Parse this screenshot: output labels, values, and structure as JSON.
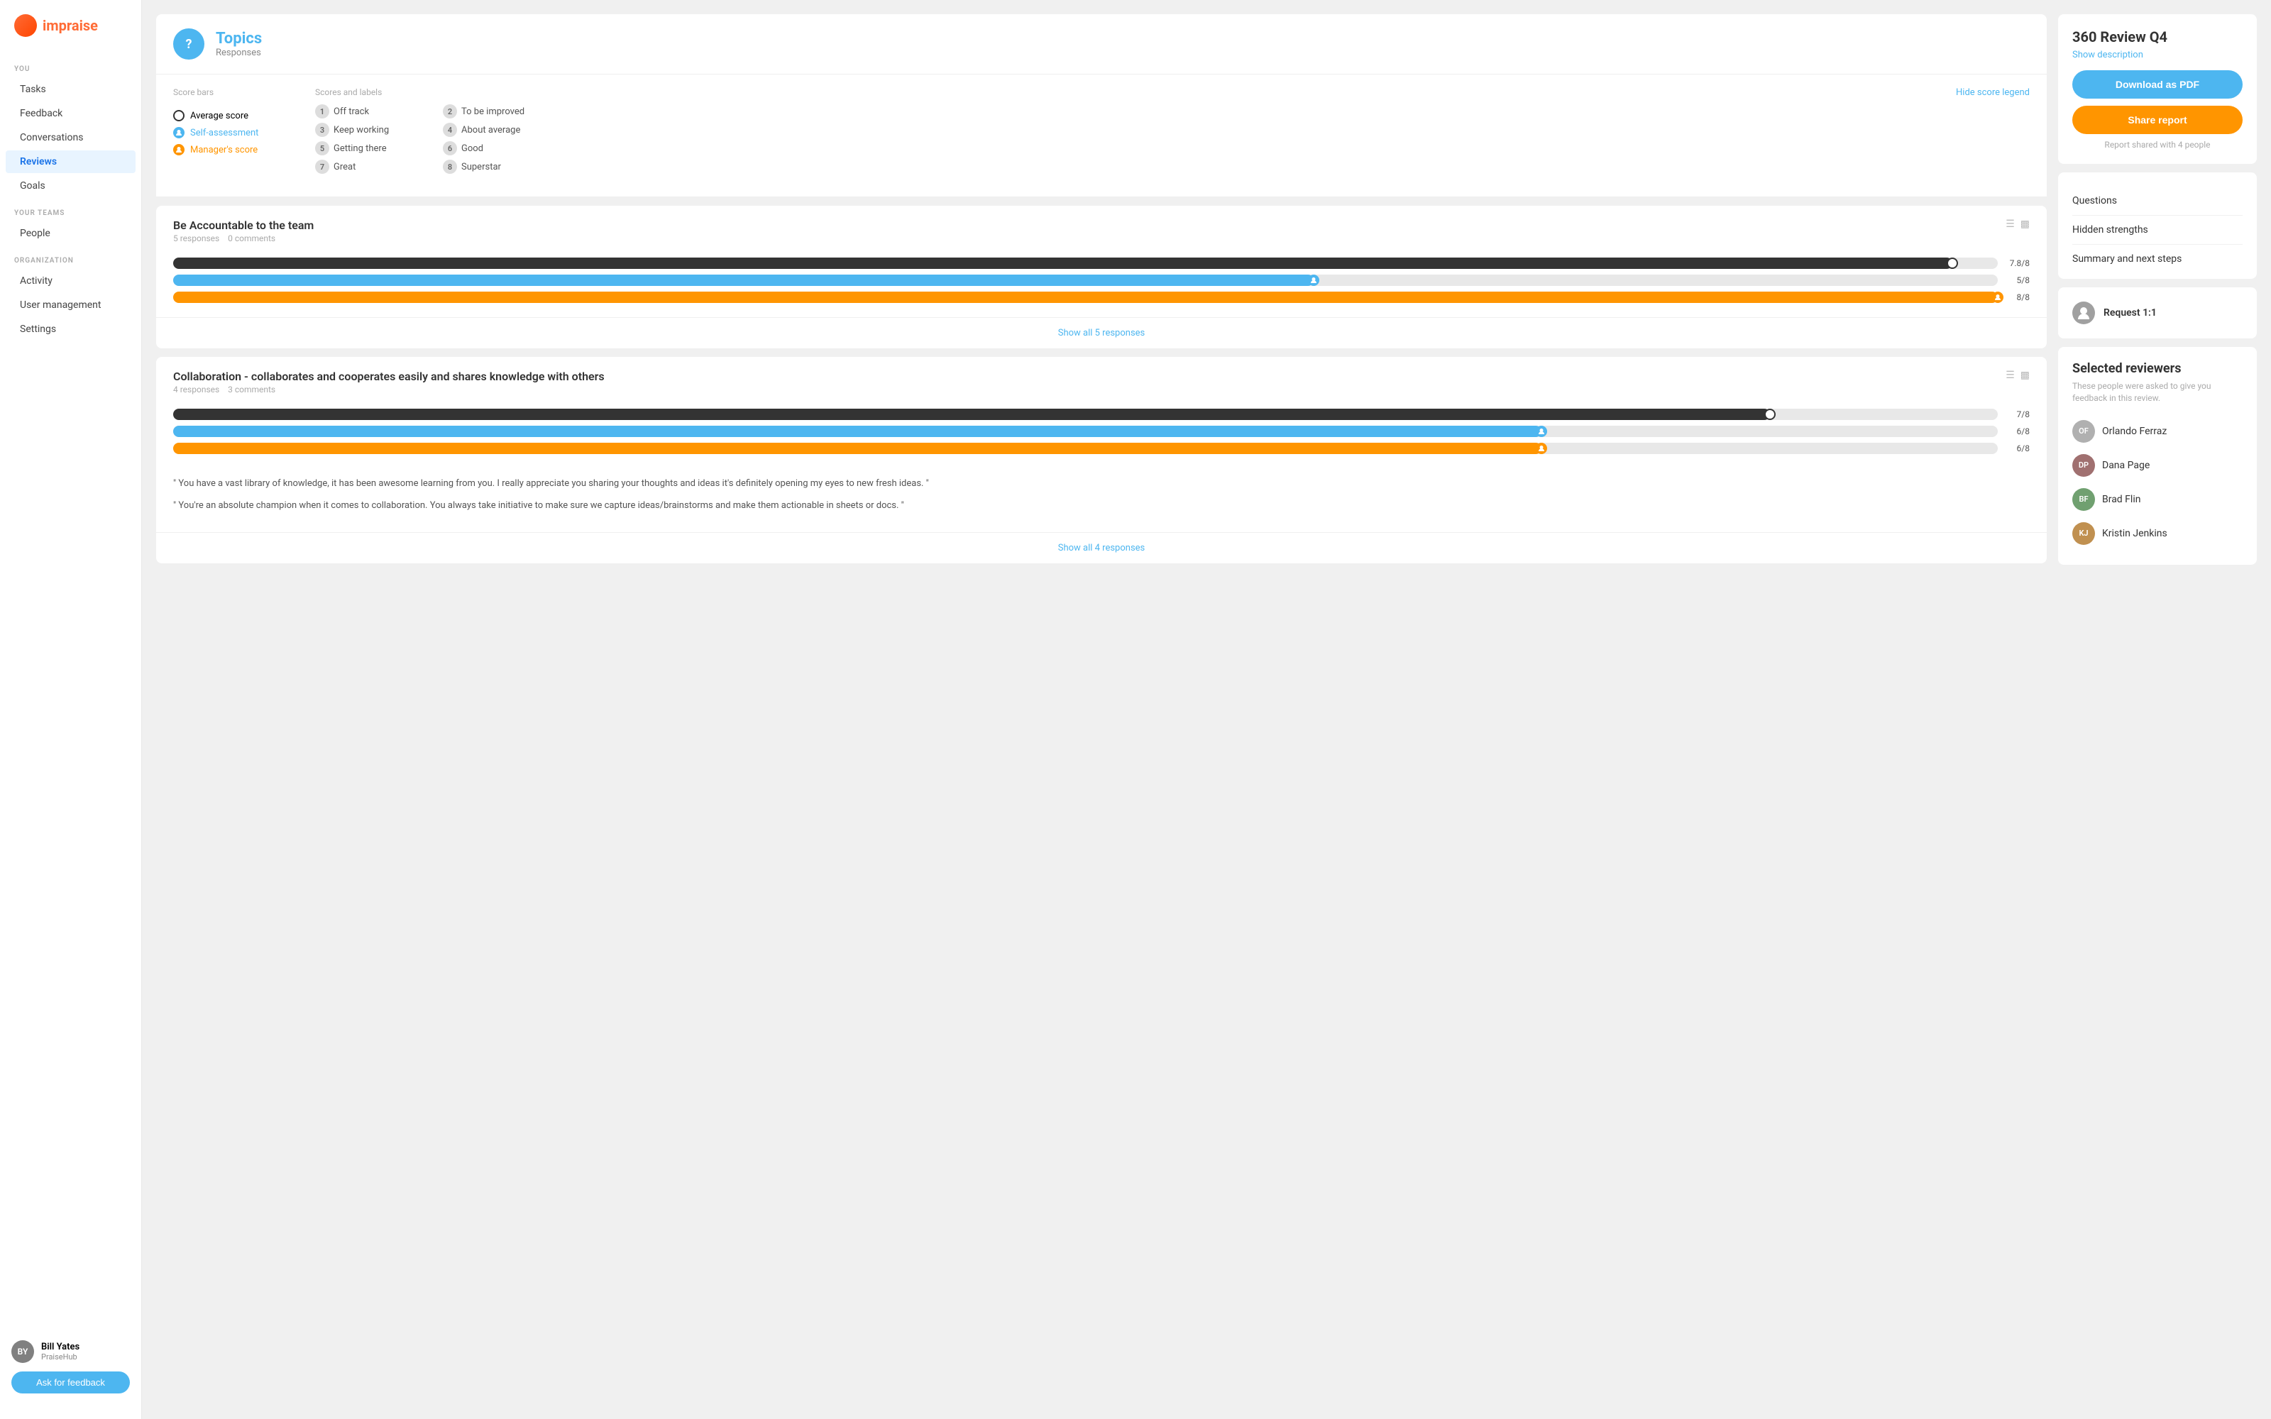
{
  "app": {
    "name": "impraise"
  },
  "sidebar": {
    "you_label": "YOU",
    "items_you": [
      {
        "id": "tasks",
        "label": "Tasks",
        "active": false
      },
      {
        "id": "feedback",
        "label": "Feedback",
        "active": false
      },
      {
        "id": "conversations",
        "label": "Conversations",
        "active": false
      },
      {
        "id": "reviews",
        "label": "Reviews",
        "active": true
      },
      {
        "id": "goals",
        "label": "Goals",
        "active": false
      }
    ],
    "your_teams_label": "YOUR TEAMS",
    "items_teams": [
      {
        "id": "people",
        "label": "People",
        "active": false
      }
    ],
    "organization_label": "ORGANIZATION",
    "items_org": [
      {
        "id": "activity",
        "label": "Activity",
        "active": false
      },
      {
        "id": "user-management",
        "label": "User management",
        "active": false
      },
      {
        "id": "settings",
        "label": "Settings",
        "active": false
      }
    ],
    "user": {
      "name": "Bill Yates",
      "org": "PraiseHub"
    },
    "ask_feedback_label": "Ask for feedback"
  },
  "topics": {
    "icon": "?",
    "title": "Topics",
    "subtitle": "Responses"
  },
  "score_legend": {
    "score_bars_label": "Score bars",
    "scores_labels_label": "Scores and labels",
    "hide_label": "Hide score legend",
    "bars": [
      {
        "id": "average",
        "label": "Average score",
        "type": "circle-outline"
      },
      {
        "id": "self",
        "label": "Self-assessment",
        "type": "blue"
      },
      {
        "id": "manager",
        "label": "Manager's score",
        "type": "orange"
      }
    ],
    "scores": [
      {
        "num": "1",
        "label": "Off track"
      },
      {
        "num": "2",
        "label": "To be improved"
      },
      {
        "num": "3",
        "label": "Keep working"
      },
      {
        "num": "4",
        "label": "About average"
      },
      {
        "num": "5",
        "label": "Getting there"
      },
      {
        "num": "6",
        "label": "Good"
      },
      {
        "num": "7",
        "label": "Great"
      },
      {
        "num": "8",
        "label": "Superstar"
      }
    ]
  },
  "topic_sections": [
    {
      "id": "accountability",
      "title": "Be Accountable to the team",
      "responses": "5 responses",
      "comments": "0 comments",
      "bars": [
        {
          "type": "dark",
          "pct": 97.5,
          "score": "7.8/8"
        },
        {
          "type": "blue",
          "pct": 62.5,
          "score": "5/8"
        },
        {
          "type": "orange",
          "pct": 100,
          "score": "8/8"
        }
      ],
      "show_responses_label": "Show all 5 responses",
      "quotes": []
    },
    {
      "id": "collaboration",
      "title": "Collaboration - collaborates and cooperates easily and shares knowledge with others",
      "responses": "4 responses",
      "comments": "3 comments",
      "bars": [
        {
          "type": "dark",
          "pct": 87.5,
          "score": "7/8"
        },
        {
          "type": "blue",
          "pct": 75,
          "score": "6/8"
        },
        {
          "type": "orange",
          "pct": 75,
          "score": "6/8"
        }
      ],
      "show_responses_label": "Show all 4 responses",
      "quotes": [
        "\" You have a vast library of knowledge, it has been awesome learning from you. I really appreciate you sharing your thoughts and ideas it's definitely opening my eyes to new fresh ideas.  \"",
        "\" You're an absolute champion when it comes to collaboration. You always take initiative to make sure we capture ideas/brainstorms and make them actionable in sheets or docs.  \""
      ]
    }
  ],
  "right_panel": {
    "review_title": "360 Review Q4",
    "show_description_label": "Show description",
    "download_label": "Download as PDF",
    "share_label": "Share report",
    "shared_info": "Report shared with 4 people",
    "questions_section": {
      "items": [
        {
          "label": "Questions"
        },
        {
          "label": "Hidden strengths"
        },
        {
          "label": "Summary and next steps"
        }
      ]
    },
    "request_11_label": "Request 1:1",
    "selected_reviewers": {
      "title": "Selected reviewers",
      "subtitle": "These people were asked to give you feedback in this review.",
      "reviewers": [
        {
          "name": "Orlando Ferraz",
          "initials": "OF",
          "color": "#b0b0b0"
        },
        {
          "name": "Dana Page",
          "initials": "DP",
          "color": "#a07070"
        },
        {
          "name": "Brad Flin",
          "initials": "BF",
          "color": "#70a070"
        },
        {
          "name": "Kristin Jenkins",
          "initials": "KJ",
          "color": "#c09050"
        }
      ]
    }
  }
}
